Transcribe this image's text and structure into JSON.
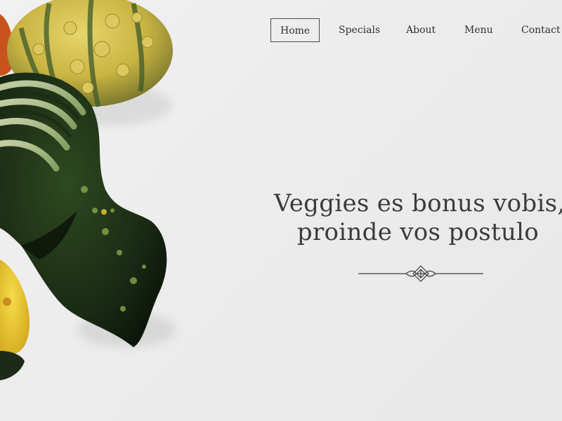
{
  "nav": {
    "items": [
      {
        "label": "Home",
        "active": true
      },
      {
        "label": "Specials",
        "active": false
      },
      {
        "label": "About",
        "active": false
      },
      {
        "label": "Menu",
        "active": false
      },
      {
        "label": "Contact",
        "active": false
      }
    ]
  },
  "hero": {
    "headline_line1": "Veggies es bonus vobis,",
    "headline_line2": "proinde vos postulo"
  },
  "colors": {
    "background": "#ececec",
    "text": "#3b3b3b",
    "nav_border": "#4a4a4a"
  }
}
